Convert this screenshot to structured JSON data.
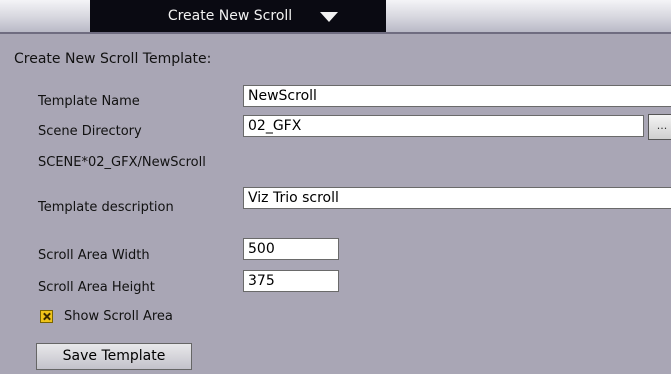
{
  "tab": {
    "title": "Create New Scroll",
    "arrow_icon": "triangle-down-icon"
  },
  "form": {
    "heading": "Create New Scroll Template:",
    "template_name_label": "Template Name",
    "template_name_value": "NewScroll",
    "scene_directory_label": "Scene Directory",
    "scene_directory_value": "02_GFX",
    "browse_label": "...",
    "scene_path": "SCENE*02_GFX/NewScroll",
    "template_description_label": "Template description",
    "template_description_value": "Viz Trio scroll",
    "scroll_width_label": "Scroll Area Width",
    "scroll_width_value": "500",
    "scroll_height_label": "Scroll Area Height",
    "scroll_height_value": "375",
    "show_scroll_area_label": "Show Scroll Area",
    "show_scroll_area_checked": true,
    "save_button_label": "Save Template"
  },
  "colors": {
    "background": "#a9a6b5",
    "tab_background": "#0a0a12",
    "checkbox": "#f0c419"
  }
}
